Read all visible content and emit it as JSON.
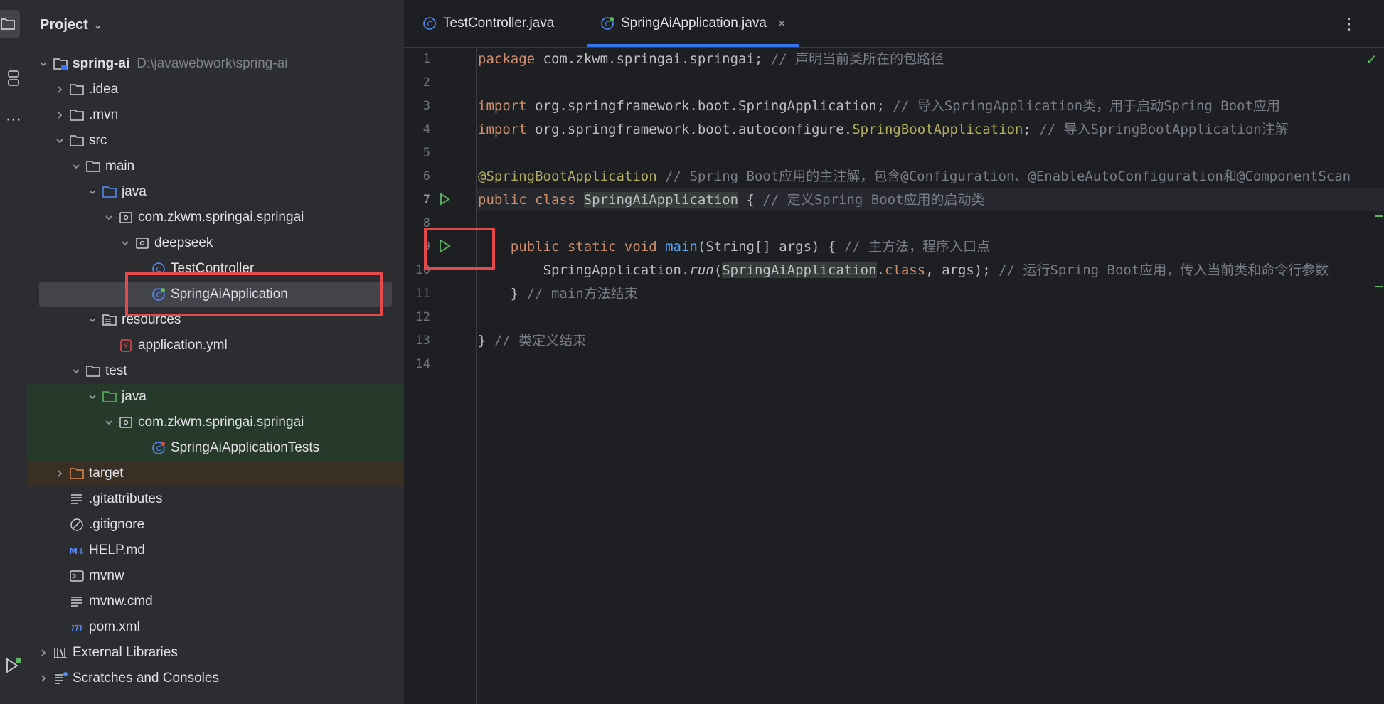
{
  "sidebar": {
    "title": "Project"
  },
  "tree": [
    {
      "label": "spring-ai",
      "hint": "D:\\javawebwork\\spring-ai",
      "icon": "module-folder-icon",
      "arrow": "down",
      "indent": 0,
      "bold": true
    },
    {
      "label": ".idea",
      "icon": "folder-icon",
      "arrow": "right",
      "indent": 1
    },
    {
      "label": ".mvn",
      "icon": "folder-icon",
      "arrow": "right",
      "indent": 1
    },
    {
      "label": "src",
      "icon": "folder-icon",
      "arrow": "down",
      "indent": 1
    },
    {
      "label": "main",
      "icon": "folder-icon",
      "arrow": "down",
      "indent": 2
    },
    {
      "label": "java",
      "icon": "source-folder-icon",
      "arrow": "down",
      "indent": 3
    },
    {
      "label": "com.zkwm.springai.springai",
      "icon": "package-icon",
      "arrow": "down",
      "indent": 4
    },
    {
      "label": "deepseek",
      "icon": "package-icon",
      "arrow": "down",
      "indent": 5
    },
    {
      "label": "TestController",
      "icon": "class-icon",
      "arrow": "",
      "indent": 6
    },
    {
      "label": "SpringAiApplication",
      "icon": "spring-class-icon",
      "arrow": "",
      "indent": 6,
      "selected": true
    },
    {
      "label": "resources",
      "icon": "resources-folder-icon",
      "arrow": "down",
      "indent": 3
    },
    {
      "label": "application.yml",
      "icon": "yaml-icon",
      "arrow": "",
      "indent": 4
    },
    {
      "label": "test",
      "icon": "folder-icon",
      "arrow": "down",
      "indent": 2
    },
    {
      "label": "java",
      "icon": "test-folder-icon",
      "arrow": "down",
      "indent": 3,
      "test": true
    },
    {
      "label": "com.zkwm.springai.springai",
      "icon": "package-icon",
      "arrow": "down",
      "indent": 4,
      "test": true
    },
    {
      "label": "SpringAiApplicationTests",
      "icon": "spring-test-class-icon",
      "arrow": "",
      "indent": 6,
      "test": true
    },
    {
      "label": "target",
      "icon": "excluded-folder-icon",
      "arrow": "right",
      "indent": 1,
      "excluded": true
    },
    {
      "label": ".gitattributes",
      "icon": "text-file-icon",
      "arrow": "",
      "indent": 1
    },
    {
      "label": ".gitignore",
      "icon": "ignore-file-icon",
      "arrow": "",
      "indent": 1
    },
    {
      "label": "HELP.md",
      "icon": "markdown-icon",
      "arrow": "",
      "indent": 1
    },
    {
      "label": "mvnw",
      "icon": "shell-script-icon",
      "arrow": "",
      "indent": 1
    },
    {
      "label": "mvnw.cmd",
      "icon": "text-file-icon",
      "arrow": "",
      "indent": 1
    },
    {
      "label": "pom.xml",
      "icon": "maven-icon",
      "arrow": "",
      "indent": 1
    },
    {
      "label": "External Libraries",
      "icon": "libraries-icon",
      "arrow": "right",
      "indent": 0
    },
    {
      "label": "Scratches and Consoles",
      "icon": "scratches-icon",
      "arrow": "right",
      "indent": 0
    }
  ],
  "tabs": [
    {
      "label": "TestController.java",
      "icon": "class-icon",
      "active": false
    },
    {
      "label": "SpringAiApplication.java",
      "icon": "spring-class-icon",
      "active": true,
      "close": "×"
    }
  ],
  "code": {
    "current_line": 7,
    "lines": [
      {
        "n": "1",
        "segs": [
          {
            "t": "package ",
            "c": "kw"
          },
          {
            "t": "com.zkwm.springai.springai; "
          },
          {
            "t": "// 声明当前类所在的包路径",
            "c": "cm"
          }
        ]
      },
      {
        "n": "2",
        "segs": []
      },
      {
        "n": "3",
        "segs": [
          {
            "t": "import ",
            "c": "kw"
          },
          {
            "t": "org.springframework.boot.SpringApplication; "
          },
          {
            "t": "// 导入SpringApplication类，用于启动Spring Boot应用",
            "c": "cm"
          }
        ]
      },
      {
        "n": "4",
        "segs": [
          {
            "t": "import ",
            "c": "kw"
          },
          {
            "t": "org.springframework.boot.autoconfigure."
          },
          {
            "t": "SpringBootApplication",
            "c": "an"
          },
          {
            "t": "; "
          },
          {
            "t": "// 导入SpringBootApplication注解",
            "c": "cm"
          }
        ]
      },
      {
        "n": "5",
        "segs": []
      },
      {
        "n": "6",
        "segs": [
          {
            "t": "@SpringBootApplication",
            "c": "an"
          },
          {
            "t": " "
          },
          {
            "t": "// Spring Boot应用的主注解，包含@Configuration、@EnableAutoConfiguration和@ComponentScan",
            "c": "cm"
          }
        ]
      },
      {
        "n": "7",
        "segs": [
          {
            "t": "public class ",
            "c": "kw"
          },
          {
            "t": "SpringAiApplication",
            "c": "hl"
          },
          {
            "t": " { "
          },
          {
            "t": "// 定义Spring Boot应用的启动类",
            "c": "cm"
          }
        ]
      },
      {
        "n": "8",
        "segs": []
      },
      {
        "n": "9",
        "segs": [
          {
            "t": "    "
          },
          {
            "t": "public static void ",
            "c": "kw"
          },
          {
            "t": "main",
            "c": "fn"
          },
          {
            "t": "(String[] args) { "
          },
          {
            "t": "// 主方法，程序入口点",
            "c": "cm"
          }
        ]
      },
      {
        "n": "10",
        "segs": [
          {
            "t": "        SpringApplication."
          },
          {
            "t": "run",
            "c": "it"
          },
          {
            "t": "("
          },
          {
            "t": "SpringAiApplication",
            "c": "hl"
          },
          {
            "t": "."
          },
          {
            "t": "class",
            "c": "kw"
          },
          {
            "t": ", args); "
          },
          {
            "t": "// 运行Spring Boot应用，传入当前类和命令行参数",
            "c": "cm"
          }
        ]
      },
      {
        "n": "11",
        "segs": [
          {
            "t": "    } "
          },
          {
            "t": "// main方法结束",
            "c": "cm"
          }
        ]
      },
      {
        "n": "12",
        "segs": []
      },
      {
        "n": "13",
        "segs": [
          {
            "t": "} "
          },
          {
            "t": "// 类定义结束",
            "c": "cm"
          }
        ]
      },
      {
        "n": "14",
        "segs": []
      }
    ]
  },
  "colors": {
    "accent": "#3574f0",
    "highlight_box": "#e5484d",
    "run": "#5fb865"
  }
}
